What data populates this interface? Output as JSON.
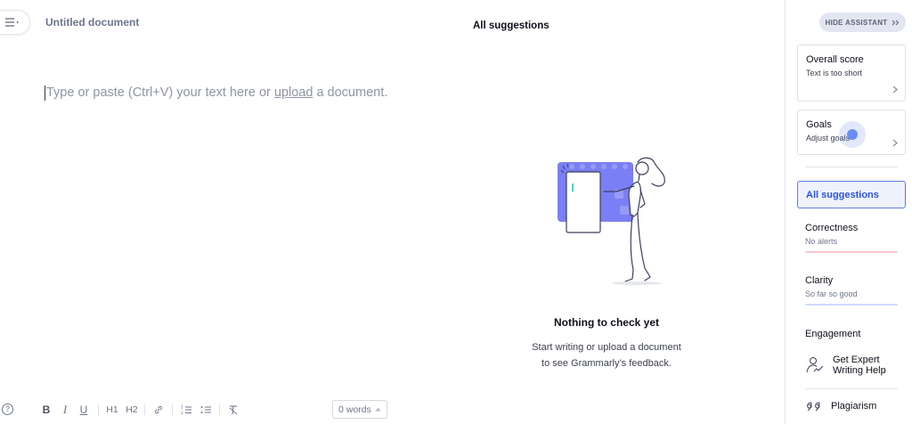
{
  "editor": {
    "document_title": "Untitled document",
    "placeholder_before": "Type or paste (Ctrl+V) your text here or ",
    "placeholder_link": "upload",
    "placeholder_after": " a document."
  },
  "toolbar": {
    "help_label": "?",
    "bold_label": "B",
    "italic_label": "I",
    "underline_label": "U",
    "h1_label": "H1",
    "h2_label": "H2",
    "word_count": "0 words"
  },
  "suggestions": {
    "header": "All suggestions",
    "empty_title": "Nothing to check yet",
    "empty_line1": "Start writing or upload a document",
    "empty_line2": "to see Grammarly’s feedback."
  },
  "assistant": {
    "hide_label": "HIDE ASSISTANT",
    "overall_score": {
      "title": "Overall score",
      "subtitle": "Text is too short"
    },
    "goals": {
      "title": "Goals",
      "subtitle": "Adjust goals"
    },
    "all_suggestions_label": "All suggestions",
    "categories": [
      {
        "title": "Correctness",
        "subtitle": "No alerts",
        "color": "#f6c9d1"
      },
      {
        "title": "Clarity",
        "subtitle": "So far so good",
        "color": "#cfdcfa"
      },
      {
        "title": "Engagement"
      }
    ],
    "expert_help": {
      "line1": "Get Expert",
      "line2": "Writing Help"
    },
    "plagiarism_label": "Plagiarism"
  },
  "colors": {
    "accent_blue": "#2c55d6",
    "illustration_purple": "#7b7ff5",
    "text_muted": "#6d758d"
  },
  "icons": {
    "menu": "hamburger-menu-icon",
    "hide": "double-chevron-right-icon",
    "chevron": "chevron-right-icon",
    "expert": "expert-writer-icon",
    "plagiarism": "quote-marks-icon"
  }
}
